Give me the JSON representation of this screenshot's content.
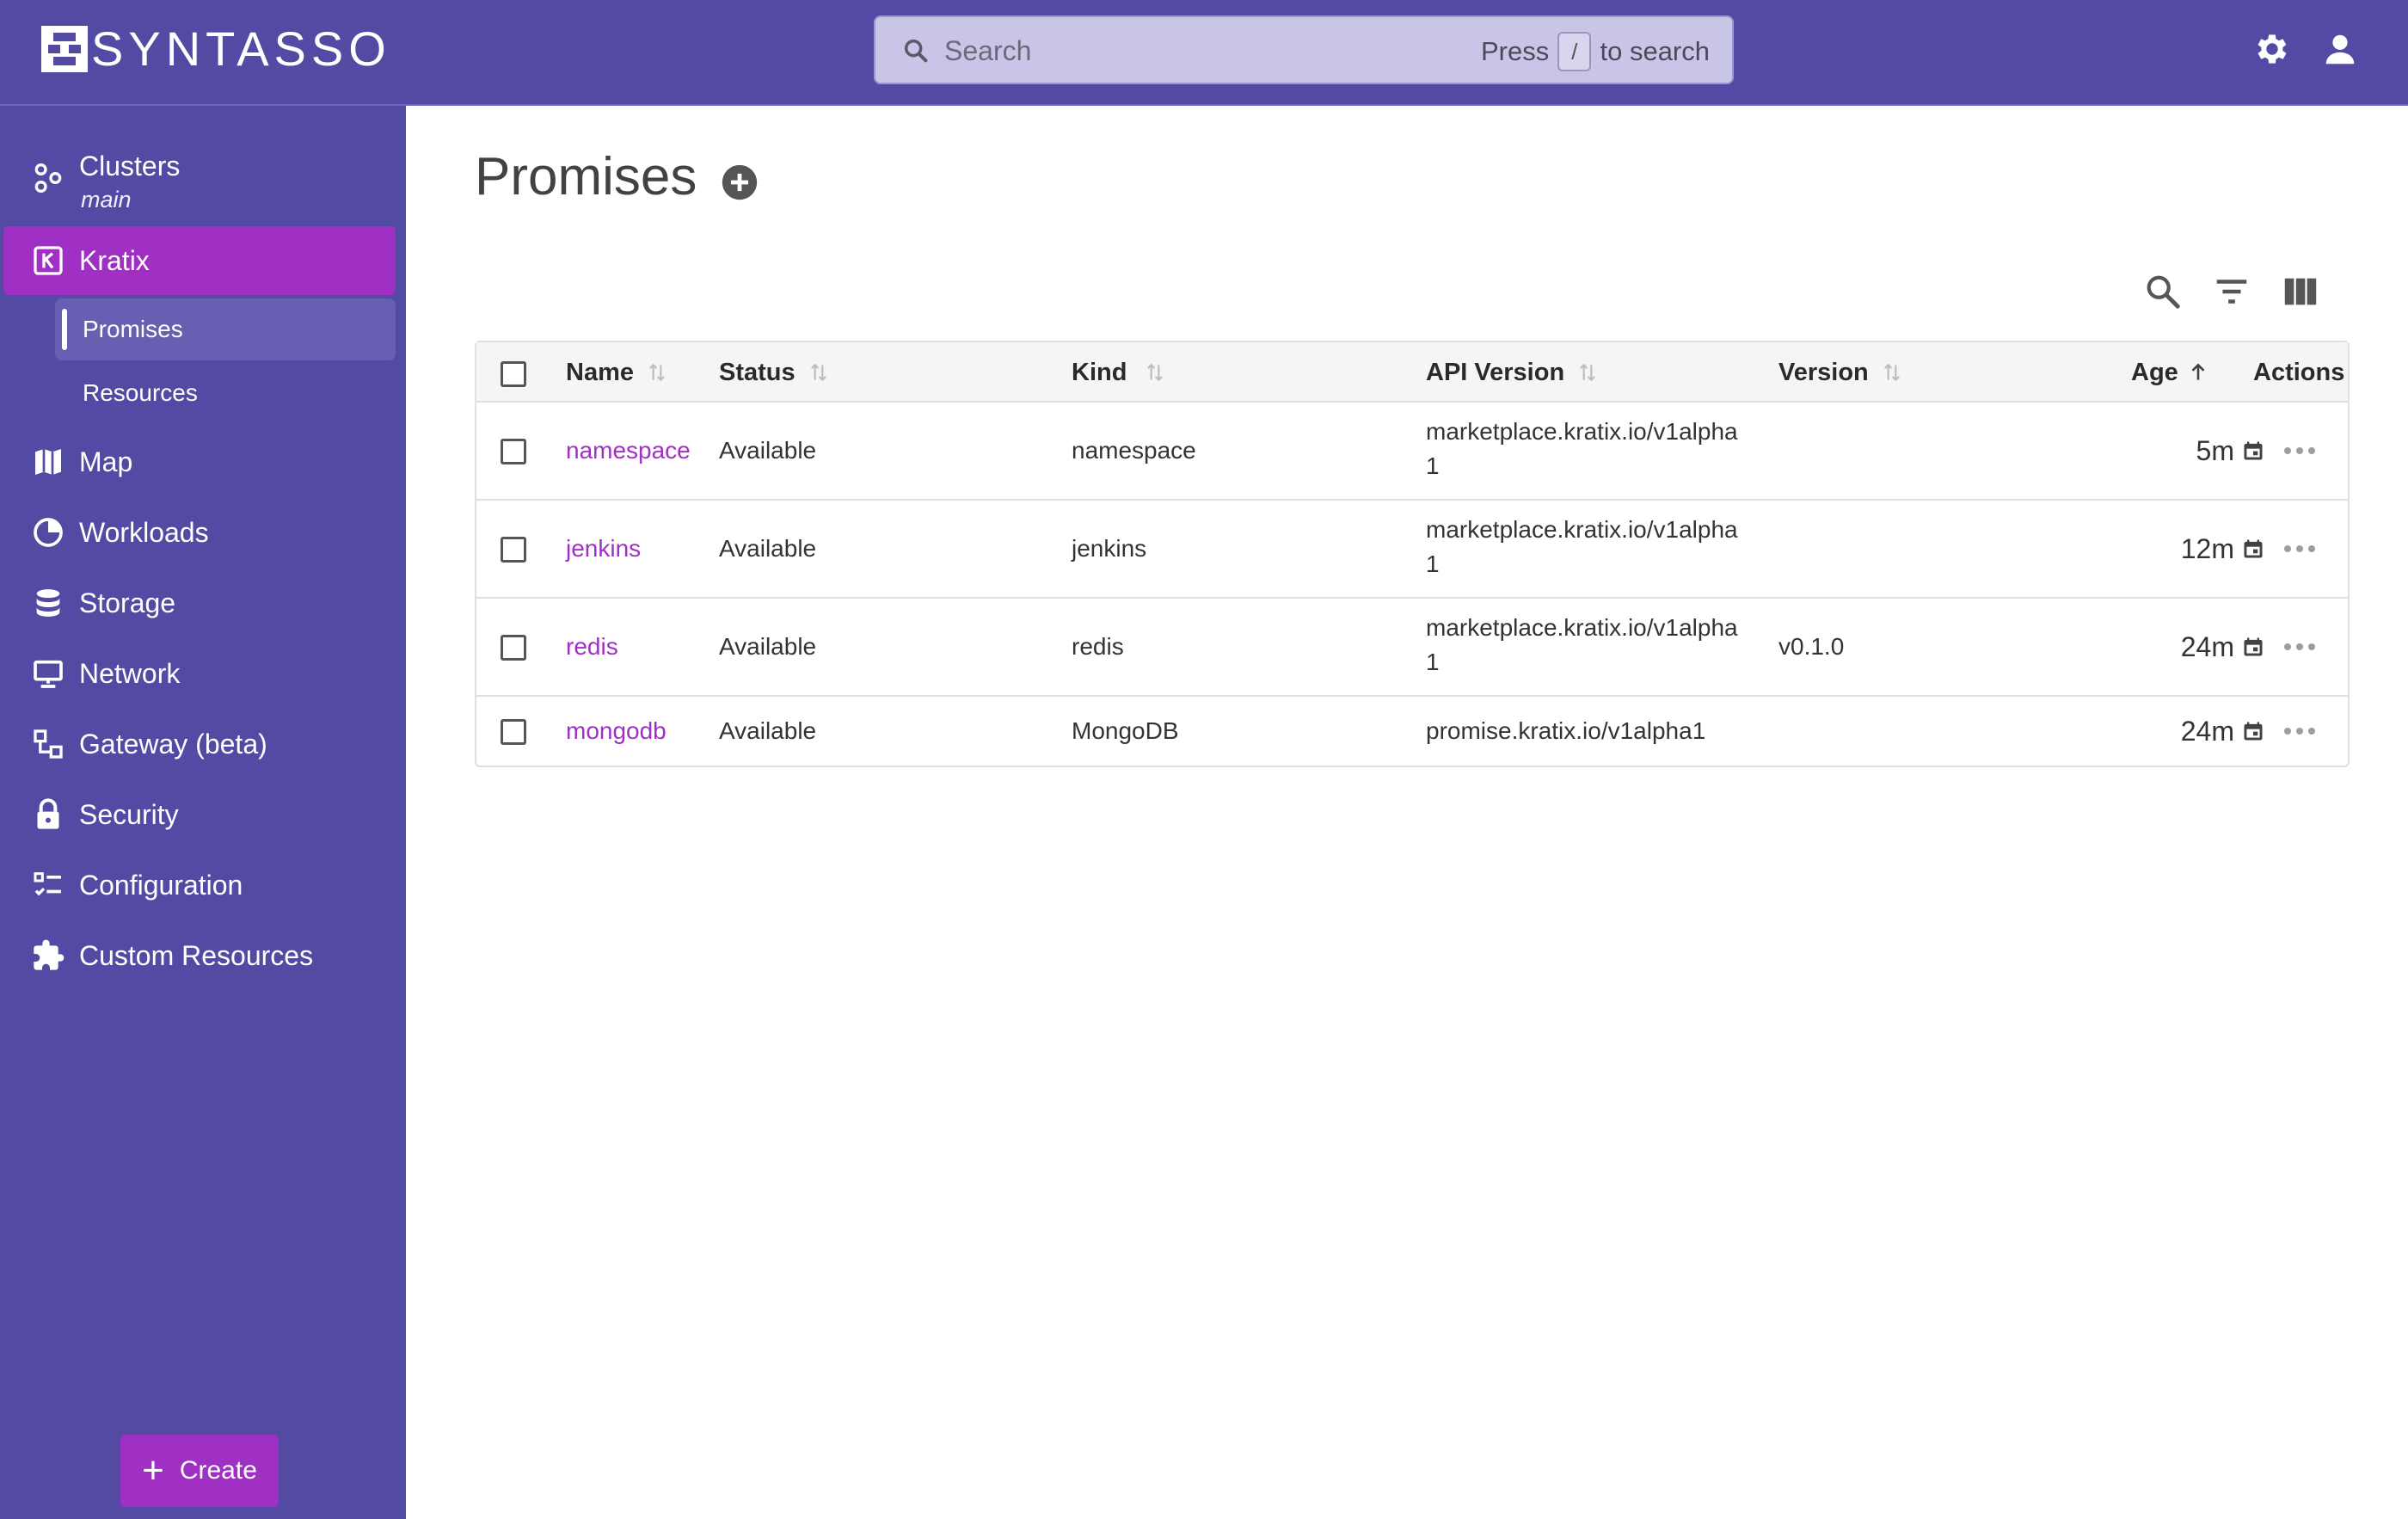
{
  "brand": {
    "name": "SYNTASSO"
  },
  "search": {
    "placeholder": "Search",
    "hint_prefix": "Press",
    "hint_key": "/",
    "hint_suffix": "to search"
  },
  "topbar": {
    "settings_icon": "gear-icon",
    "account_icon": "user-icon"
  },
  "sidebar": {
    "clusters": {
      "label": "Clusters",
      "sub": "main"
    },
    "kratix": {
      "label": "Kratix",
      "children": [
        {
          "label": "Promises"
        },
        {
          "label": "Resources"
        }
      ]
    },
    "items": [
      {
        "label": "Map",
        "icon": "map-icon"
      },
      {
        "label": "Workloads",
        "icon": "pie-chart-icon"
      },
      {
        "label": "Storage",
        "icon": "database-icon"
      },
      {
        "label": "Network",
        "icon": "monitor-icon"
      },
      {
        "label": "Gateway (beta)",
        "icon": "gateway-icon"
      },
      {
        "label": "Security",
        "icon": "lock-icon"
      },
      {
        "label": "Configuration",
        "icon": "checklist-icon"
      },
      {
        "label": "Custom Resources",
        "icon": "puzzle-icon"
      }
    ],
    "create_label": "Create"
  },
  "page": {
    "title": "Promises"
  },
  "table": {
    "columns": [
      "Name",
      "Status",
      "Kind",
      "API Version",
      "Version",
      "Age",
      "Actions"
    ],
    "rows": [
      {
        "name": "namespace",
        "status": "Available",
        "kind": "namespace",
        "api_line1": "marketplace.kratix.io/v1alpha",
        "api_line2": "1",
        "version": "",
        "age": "5m"
      },
      {
        "name": "jenkins",
        "status": "Available",
        "kind": "jenkins",
        "api_line1": "marketplace.kratix.io/v1alpha",
        "api_line2": "1",
        "version": "",
        "age": "12m"
      },
      {
        "name": "redis",
        "status": "Available",
        "kind": "redis",
        "api_line1": "marketplace.kratix.io/v1alpha",
        "api_line2": "1",
        "version": "v0.1.0",
        "age": "24m"
      },
      {
        "name": "mongodb",
        "status": "Available",
        "kind": "MongoDB",
        "api_line1": "promise.kratix.io/v1alpha1",
        "api_line2": "",
        "version": "",
        "age": "24m"
      }
    ]
  },
  "colors": {
    "brand_purple": "#534ba3",
    "accent_magenta": "#a02fc4"
  }
}
